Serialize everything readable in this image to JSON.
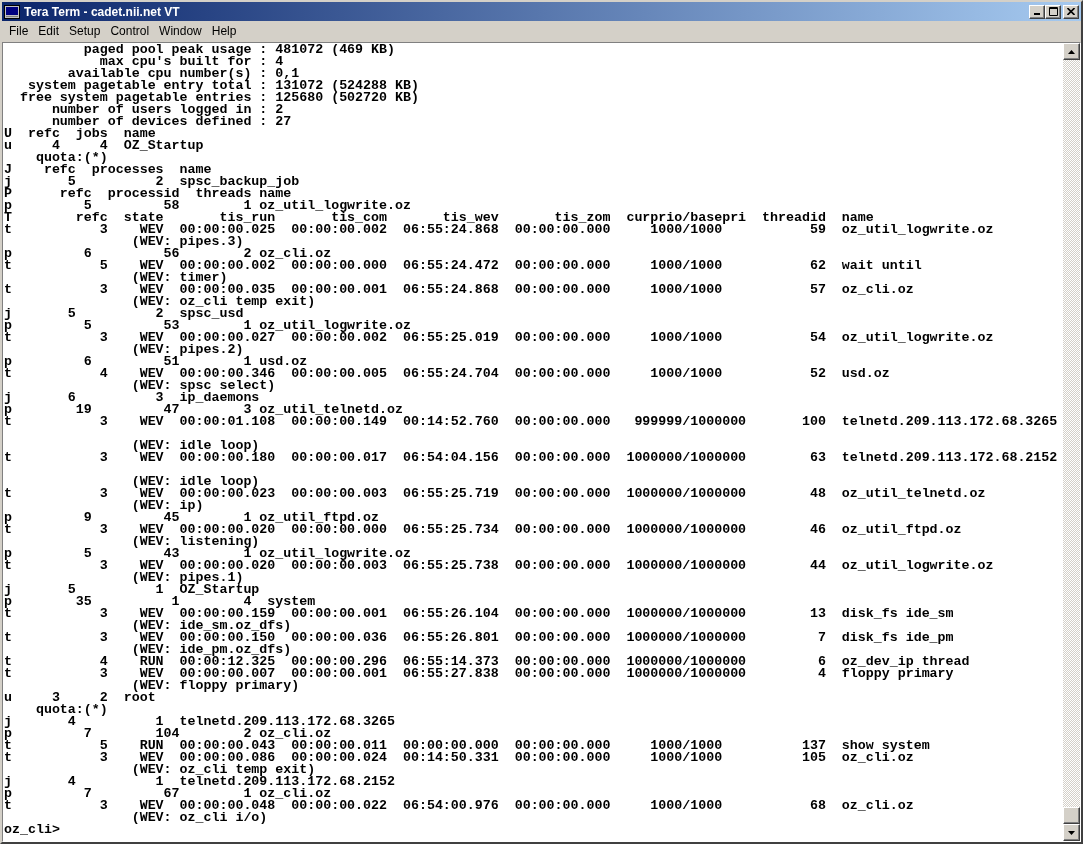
{
  "window": {
    "title": "Tera Term - cadet.nii.net VT"
  },
  "menu": [
    "File",
    "Edit",
    "Setup",
    "Control",
    "Window",
    "Help"
  ],
  "terminal": {
    "lines": [
      {
        "text": "          paged pool peak usage : 481072 (469 KB)",
        "wrapped": false
      },
      {
        "text": "            max cpu's built for : 4",
        "wrapped": false
      },
      {
        "text": "        available cpu number(s) : 0,1",
        "wrapped": false
      },
      {
        "text": "   system pagetable entry total : 131072 (524288 KB)",
        "wrapped": false
      },
      {
        "text": "  free system pagetable entries : 125680 (502720 KB)",
        "wrapped": false
      },
      {
        "text": "      number of users logged in : 2",
        "wrapped": false
      },
      {
        "text": "      number of devices defined : 27",
        "wrapped": false
      },
      {
        "text": "U  refc  jobs  name",
        "wrapped": false
      },
      {
        "text": "u     4     4  OZ_Startup",
        "wrapped": false
      },
      {
        "text": "    quota:(*)",
        "wrapped": false
      },
      {
        "text": "J    refc  processes  name",
        "wrapped": false
      },
      {
        "text": "j       5          2  spsc_backup_job",
        "wrapped": false
      },
      {
        "text": "P      refc  processid  threads name",
        "wrapped": false
      },
      {
        "text": "p         5         58        1 oz_util_logwrite.oz",
        "wrapped": false
      },
      {
        "text": "T        refc  state       tis_run       tis_com       tis_wev       tis_zom  curprio/basepri  threadid  name",
        "wrapped": false
      },
      {
        "text": "t           3    WEV  00:00:00.025  00:00:00.002  06:55:24.868  00:00:00.000     1000/1000           59  oz_util_logwrite.oz",
        "wrapped": false
      },
      {
        "text": "                (WEV: pipes.3)",
        "wrapped": false
      },
      {
        "text": "p         6         56        2 oz_cli.oz",
        "wrapped": false
      },
      {
        "text": "t           5    WEV  00:00:00.002  00:00:00.000  06:55:24.472  00:00:00.000     1000/1000           62  wait until",
        "wrapped": false
      },
      {
        "text": "                (WEV: timer)",
        "wrapped": false
      },
      {
        "text": "t           3    WEV  00:00:00.035  00:00:00.001  06:55:24.868  00:00:00.000     1000/1000           57  oz_cli.oz",
        "wrapped": false
      },
      {
        "text": "                (WEV: oz_cli temp exit)",
        "wrapped": false
      },
      {
        "text": "j       5          2  spsc_usd",
        "wrapped": false
      },
      {
        "text": "p         5         53        1 oz_util_logwrite.oz",
        "wrapped": false
      },
      {
        "text": "t           3    WEV  00:00:00.027  00:00:00.002  06:55:25.019  00:00:00.000     1000/1000           54  oz_util_logwrite.oz",
        "wrapped": false
      },
      {
        "text": "                (WEV: pipes.2)",
        "wrapped": false
      },
      {
        "text": "p         6         51        1 usd.oz",
        "wrapped": false
      },
      {
        "text": "t           4    WEV  00:00:00.346  00:00:00.005  06:55:24.704  00:00:00.000     1000/1000           52  usd.oz",
        "wrapped": false
      },
      {
        "text": "                (WEV: spsc select)",
        "wrapped": false
      },
      {
        "text": "j       6          3  ip_daemons",
        "wrapped": false
      },
      {
        "text": "p        19         47        3 oz_util_telnetd.oz",
        "wrapped": false
      },
      {
        "text": "t           3    WEV  00:00:01.108  00:00:00.149  00:14:52.760  00:00:00.000   999999/1000000       100  telnetd.209.113.172.68.3265",
        "wrapped": true
      },
      {
        "text": "                (WEV: idle loop)",
        "wrapped": false
      },
      {
        "text": "t           3    WEV  00:00:00.180  00:00:00.017  06:54:04.156  00:00:00.000  1000000/1000000        63  telnetd.209.113.172.68.2152",
        "wrapped": true
      },
      {
        "text": "                (WEV: idle loop)",
        "wrapped": false
      },
      {
        "text": "t           3    WEV  00:00:00.023  00:00:00.003  06:55:25.719  00:00:00.000  1000000/1000000        48  oz_util_telnetd.oz",
        "wrapped": false
      },
      {
        "text": "                (WEV: ip)",
        "wrapped": false
      },
      {
        "text": "p         9         45        1 oz_util_ftpd.oz",
        "wrapped": false
      },
      {
        "text": "t           3    WEV  00:00:00.020  00:00:00.000  06:55:25.734  00:00:00.000  1000000/1000000        46  oz_util_ftpd.oz",
        "wrapped": false
      },
      {
        "text": "                (WEV: listening)",
        "wrapped": false
      },
      {
        "text": "p         5         43        1 oz_util_logwrite.oz",
        "wrapped": false
      },
      {
        "text": "t           3    WEV  00:00:00.020  00:00:00.003  06:55:25.738  00:00:00.000  1000000/1000000        44  oz_util_logwrite.oz",
        "wrapped": false
      },
      {
        "text": "                (WEV: pipes.1)",
        "wrapped": false
      },
      {
        "text": "j       5          1  OZ_Startup",
        "wrapped": false
      },
      {
        "text": "p        35          1        4  system",
        "wrapped": false
      },
      {
        "text": "t           3    WEV  00:00:00.159  00:00:00.001  06:55:26.104  00:00:00.000  1000000/1000000        13  disk_fs ide_sm",
        "wrapped": false
      },
      {
        "text": "                (WEV: ide_sm.oz_dfs)",
        "wrapped": false
      },
      {
        "text": "t           3    WEV  00:00:00.150  00:00:00.036  06:55:26.801  00:00:00.000  1000000/1000000         7  disk_fs ide_pm",
        "wrapped": false
      },
      {
        "text": "                (WEV: ide_pm.oz_dfs)",
        "wrapped": false
      },
      {
        "text": "t           4    RUN  00:00:12.325  00:00:00.296  06:55:14.373  00:00:00.000  1000000/1000000         6  oz_dev_ip thread",
        "wrapped": false
      },
      {
        "text": "t           3    WEV  00:00:00.007  00:00:00.001  06:55:27.838  00:00:00.000  1000000/1000000         4  floppy primary",
        "wrapped": false
      },
      {
        "text": "                (WEV: floppy primary)",
        "wrapped": false
      },
      {
        "text": "u     3     2  root",
        "wrapped": false
      },
      {
        "text": "    quota:(*)",
        "wrapped": false
      },
      {
        "text": "j       4          1  telnetd.209.113.172.68.3265",
        "wrapped": false
      },
      {
        "text": "p         7        104        2 oz_cli.oz",
        "wrapped": false
      },
      {
        "text": "t           5    RUN  00:00:00.043  00:00:00.011  00:00:00.000  00:00:00.000     1000/1000          137  show system",
        "wrapped": false
      },
      {
        "text": "t           3    WEV  00:00:00.086  00:00:00.024  00:14:50.331  00:00:00.000     1000/1000          105  oz_cli.oz",
        "wrapped": false
      },
      {
        "text": "                (WEV: oz_cli temp exit)",
        "wrapped": false
      },
      {
        "text": "j       4          1  telnetd.209.113.172.68.2152",
        "wrapped": false
      },
      {
        "text": "p         7         67        1 oz_cli.oz",
        "wrapped": false
      },
      {
        "text": "t           3    WEV  00:00:00.048  00:00:00.022  06:54:00.976  00:00:00.000     1000/1000           68  oz_cli.oz",
        "wrapped": false
      },
      {
        "text": "                (WEV: oz_cli i/o)",
        "wrapped": false
      },
      {
        "text": "oz_cli>",
        "wrapped": false
      }
    ]
  }
}
